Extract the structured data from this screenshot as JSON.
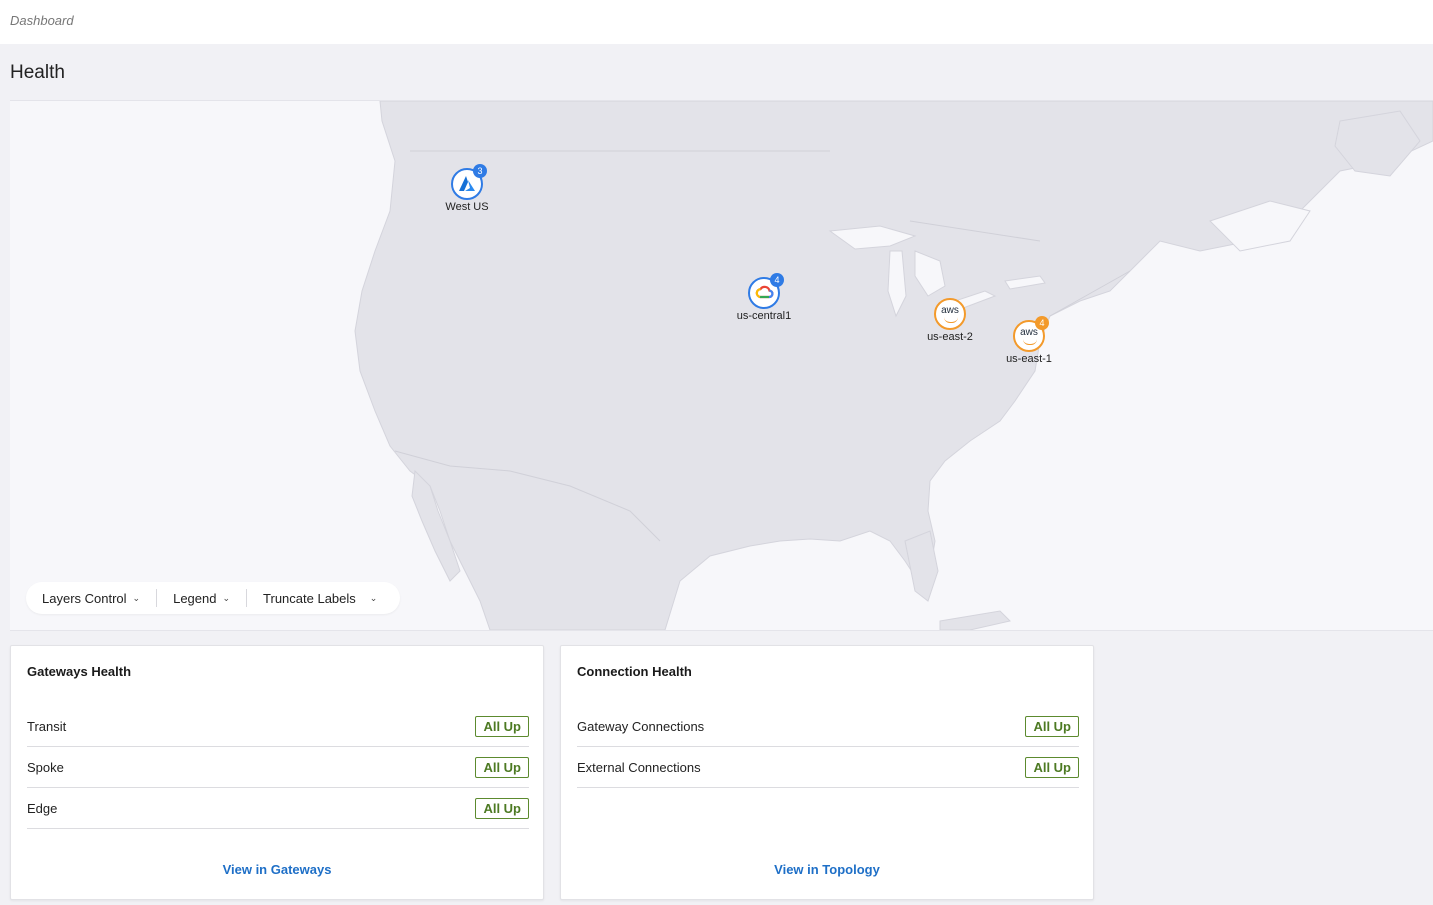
{
  "breadcrumb": "Dashboard",
  "page_title": "Health",
  "map": {
    "markers": [
      {
        "label": "West US",
        "provider": "azure",
        "count": "3",
        "color": "#2f7be5"
      },
      {
        "label": "us-central1",
        "provider": "gcp",
        "count": "4",
        "color": "#2f7be5"
      },
      {
        "label": "us-east-2",
        "provider": "aws",
        "icon_text": "aws",
        "count": "",
        "color": "#f39a2b"
      },
      {
        "label": "us-east-1",
        "provider": "aws",
        "icon_text": "aws",
        "count": "4",
        "color": "#f39a2b"
      }
    ],
    "controls": [
      {
        "label": "Layers Control"
      },
      {
        "label": "Legend"
      },
      {
        "label": "Truncate Labels"
      }
    ]
  },
  "gateways_health": {
    "title": "Gateways Health",
    "rows": [
      {
        "label": "Transit",
        "status": "All Up"
      },
      {
        "label": "Spoke",
        "status": "All Up"
      },
      {
        "label": "Edge",
        "status": "All Up"
      }
    ],
    "link": "View in Gateways"
  },
  "connection_health": {
    "title": "Connection Health",
    "rows": [
      {
        "label": "Gateway Connections",
        "status": "All Up"
      },
      {
        "label": "External Connections",
        "status": "All Up"
      }
    ],
    "link": "View in Topology"
  },
  "colors": {
    "status_green": "#4d7a23",
    "link_blue": "#1e6fc7",
    "azure_blue": "#2f7be5",
    "aws_orange": "#f39a2b"
  }
}
